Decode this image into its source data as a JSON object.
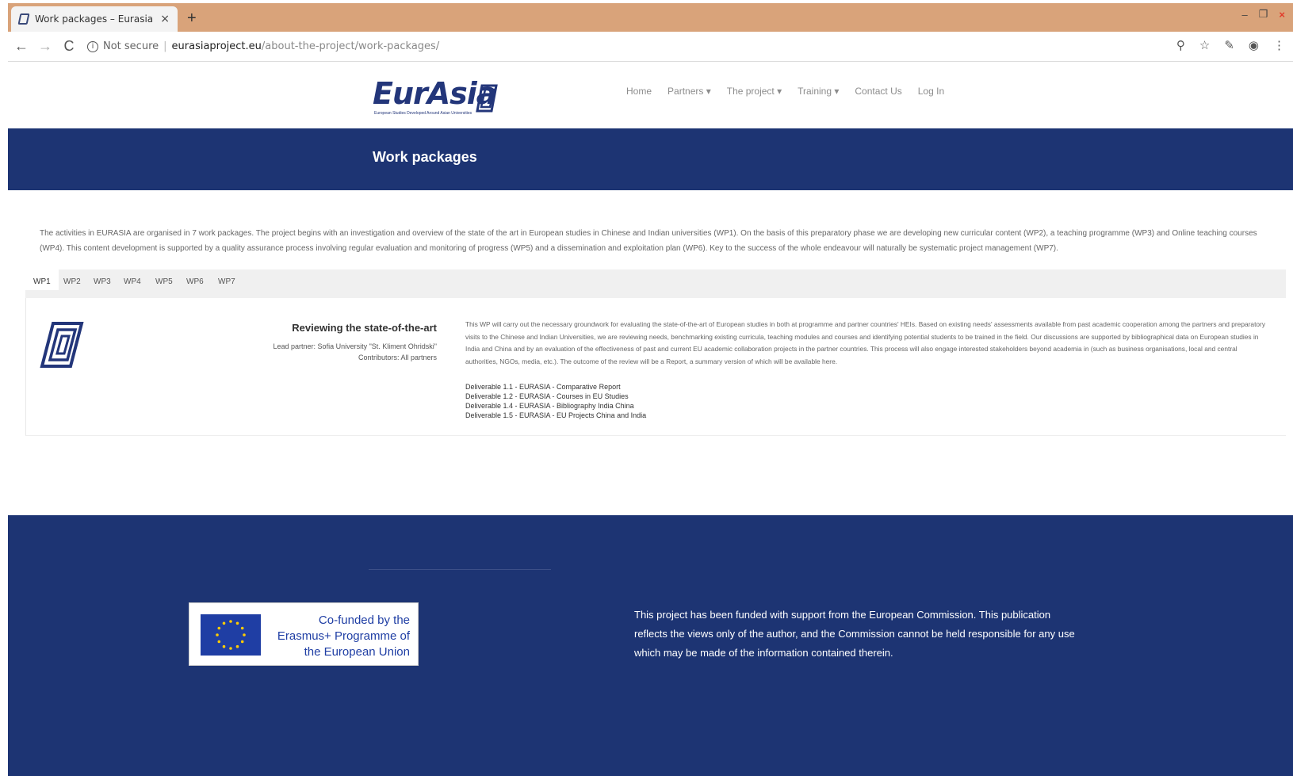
{
  "browser": {
    "tab_title": "Work packages – Eurasia",
    "tab_close": "×",
    "new_tab": "+",
    "window_controls": [
      "–",
      "❐",
      "×"
    ],
    "nav": {
      "back": "←",
      "forward": "→",
      "reload": "C"
    },
    "security_label": "Not secure",
    "url_host": "eurasiaproject.eu",
    "url_path": "/about-the-project/work-packages/",
    "right_icons": [
      "⚲",
      "☆",
      "✎",
      "◉",
      "⋮"
    ]
  },
  "site": {
    "logo_text": "EurAsia",
    "logo_sub": "European Studies Developed Around Asian Universities",
    "nav": [
      "Home",
      "Partners ▾",
      "The project ▾",
      "Training ▾",
      "Contact Us",
      "Log In"
    ]
  },
  "banner": {
    "title": "Work packages"
  },
  "intro": "The activities in EURASIA are organised in 7 work packages. The project begins with an investigation and overview of the state of the art in European studies in Chinese and Indian universities (WP1). On the basis of this preparatory phase we are developing new curricular content (WP2), a teaching programme (WP3) and Online teaching courses (WP4). This content development is supported by a quality assurance process involving regular evaluation and monitoring of progress (WP5) and a dissemination and exploitation plan (WP6). Key to the success of the whole endeavour will naturally be systematic project management (WP7).",
  "tabs": [
    "WP1",
    "WP2",
    "WP3",
    "WP4",
    "WP5",
    "WP6",
    "WP7"
  ],
  "wp1": {
    "title": "Reviewing the state-of-the-art",
    "lead": "Lead partner: Sofia University \"St. Kliment Ohridski\"",
    "contributors": "Contributors: All partners",
    "description": "This WP will carry out the necessary groundwork for evaluating the state-of-the-art of European studies in both at programme and partner countries' HEIs. Based on existing needs' assessments available from past academic cooperation among the partners and preparatory visits to the Chinese and Indian Universities, we are reviewing needs, benchmarking existing curricula, teaching modules and courses and identifying potential students to be trained in the field. Our discussions are supported by bibliographical data on European studies in India and China and by an evaluation of the effectiveness of past and current EU academic collaboration projects in the partner countries. This process will also engage interested stakeholders beyond academia in (such as business organisations, local and central authorities, NGOs, media, etc.). The outcome of the review will be a Report, a summary version of which will be available here.",
    "deliverables": [
      "Deliverable 1.1 - EURASIA - Comparative Report",
      "Deliverable 1.2 - EURASIA - Courses in EU Studies",
      "Deliverable 1.4 - EURASIA - Bibliography India China",
      "Deliverable 1.5 - EURASIA - EU Projects China and India"
    ]
  },
  "footer": {
    "eu_text": "Co-funded by the Erasmus+ Programme of the European Union",
    "disclaimer": "This project has been funded with support from the European Commission. This publication reflects the views only of the author, and the Commission cannot be held responsible for any use which may be made of the information contained therein."
  },
  "colors": {
    "brand_blue": "#1d3473",
    "tab_bar": "#d9a37a",
    "eu_blue": "#1f3ea4",
    "eu_star": "#ffcc00"
  }
}
